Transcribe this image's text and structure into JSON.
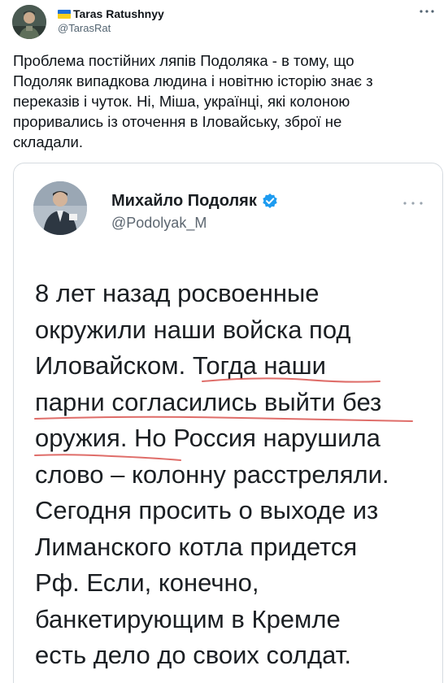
{
  "tweet": {
    "display_name": "Taras Ratushnyy",
    "handle": "@TarasRat",
    "more_icon": "more-horizontal-icon",
    "text": "Проблема постійних ляпів Подоляка - в тому, що\nПодоляк випадкова людина і новітню історію знає з\nпереказів і чуток. Ні, Міша, українці, які колоною\nпроривались із оточення в Іловайську, зброї не\nскладали.",
    "flag_colors": [
      "#1d6fd6",
      "#f6cf1d"
    ]
  },
  "quoted": {
    "display_name": "Михайло Подоляк",
    "handle": "@Podolyak_M",
    "verified_color": "#1d9bf0",
    "body": "8 лет назад росвоенные\nокружили наши войска под\nИловайском. Тогда наши\nпарни согласились выйти без\nоружия. Но Россия нарушила\nслово – колонну расстреляли.\nСегодня просить о выходе из\nЛиманского котла придется\nРф. Если, конечно,\nбанкетирующим в Кремле\nесть дело до своих солдат.",
    "underline_color": "#d9534f"
  }
}
